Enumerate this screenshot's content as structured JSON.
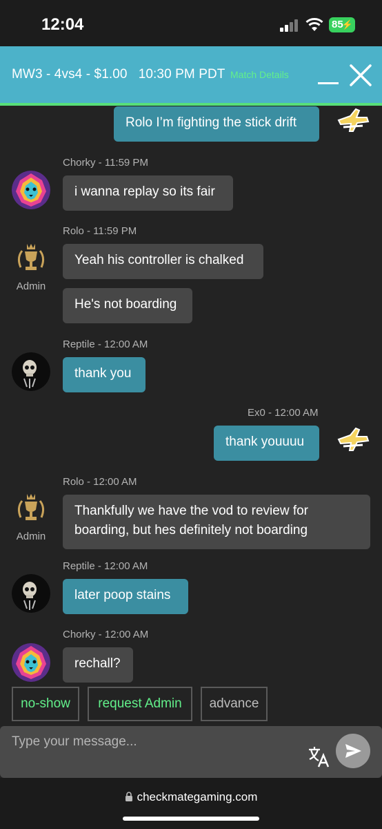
{
  "status_bar": {
    "time": "12:04",
    "battery": "85"
  },
  "header": {
    "title": "MW3 - 4vs4 - $1.00   10:30 PM PDT",
    "match_details": "Match Details"
  },
  "messages": [
    {
      "text": "Rolo I’m fighting the stick drift"
    },
    {
      "meta": "Chorky - 11:59 PM",
      "text": "i wanna replay so its fair"
    },
    {
      "meta": "Rolo - 11:59 PM",
      "text": "Yeah his controller is chalked",
      "text2": "He's not boarding",
      "badge": "Admin"
    },
    {
      "meta": "Reptile - 12:00 AM",
      "text": "thank you"
    },
    {
      "meta": "Ex0 - 12:00 AM",
      "text": "thank youuuu"
    },
    {
      "meta": "Rolo - 12:00 AM",
      "text": "Thankfully we have the vod to review for boarding, but hes definitely not boarding",
      "badge": "Admin"
    },
    {
      "meta": "Reptile - 12:00 AM",
      "text": "later poop stains"
    },
    {
      "meta": "Chorky - 12:00 AM",
      "text": "rechall?"
    }
  ],
  "actions": [
    {
      "label": "no-show",
      "color": "#62f08a"
    },
    {
      "label": "request Admin",
      "color": "#62f08a"
    },
    {
      "label": "advance",
      "color": "#bdbdbd"
    }
  ],
  "composer": {
    "placeholder": "Type your message..."
  },
  "browser": {
    "url": "checkmategaming.com"
  },
  "colors": {
    "header": "#4cb2c9",
    "accent_green": "#62f08a",
    "bubble_blue": "#3b8ea1",
    "bubble_grey": "#474747"
  }
}
